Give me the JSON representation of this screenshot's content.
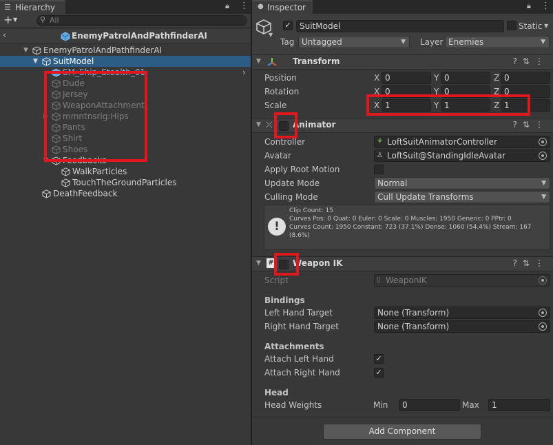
{
  "hierarchy": {
    "tab_label": "Hierarchy",
    "search_placeholder": "All",
    "scene_title": "EnemyPatrolAndPathfinderAI",
    "items": [
      {
        "label": "EnemyPatrolAndPathfinderAI"
      },
      {
        "label": "SuitModel"
      },
      {
        "label": "SM_Ship_Stealth_01"
      },
      {
        "label": "Dude"
      },
      {
        "label": "Jersey"
      },
      {
        "label": "WeaponAttachment"
      },
      {
        "label": "mmntnsrig:Hips"
      },
      {
        "label": "Pants"
      },
      {
        "label": "Shirt"
      },
      {
        "label": "Shoes"
      },
      {
        "label": "Feedbacks"
      },
      {
        "label": "WalkParticles"
      },
      {
        "label": "TouchTheGroundParticles"
      },
      {
        "label": "DeathFeedback"
      }
    ]
  },
  "inspector": {
    "tab_label": "Inspector",
    "object_name": "SuitModel",
    "static_label": "Static",
    "tag_label": "Tag",
    "tag_value": "Untagged",
    "layer_label": "Layer",
    "layer_value": "Enemies",
    "transform": {
      "title": "Transform",
      "position_label": "Position",
      "rotation_label": "Rotation",
      "scale_label": "Scale",
      "x": "X",
      "y": "Y",
      "z": "Z",
      "position": [
        "0",
        "0",
        "0"
      ],
      "rotation": [
        "0",
        "0",
        "0"
      ],
      "scale": [
        "1",
        "1",
        "1"
      ]
    },
    "animator": {
      "title": "Animator",
      "controller_label": "Controller",
      "controller_value": "LoftSuitAnimatorController",
      "avatar_label": "Avatar",
      "avatar_value": "LoftSuit@StandingIdleAvatar",
      "apply_root_motion_label": "Apply Root Motion",
      "update_mode_label": "Update Mode",
      "update_mode_value": "Normal",
      "culling_mode_label": "Culling Mode",
      "culling_mode_value": "Cull Update Transforms",
      "info_line1": "Clip Count: 15",
      "info_line2": "Curves Pos: 0 Quat: 0 Euler: 0 Scale: 0 Muscles: 1950 Generic: 0 PPtr: 0",
      "info_line3": "Curves Count: 1950 Constant: 723 (37.1%) Dense: 1060 (54.4%) Stream: 167",
      "info_line4": "(8.6%)"
    },
    "weapon_ik": {
      "title": "Weapon IK",
      "script_label": "Script",
      "script_value": "WeaponIK",
      "bindings_header": "Bindings",
      "left_hand_target_label": "Left Hand Target",
      "left_hand_target_value": "None (Transform)",
      "right_hand_target_label": "Right Hand Target",
      "right_hand_target_value": "None (Transform)",
      "attachments_header": "Attachments",
      "attach_left_label": "Attach Left Hand",
      "attach_right_label": "Attach Right Hand",
      "head_header": "Head",
      "head_weights_label": "Head Weights",
      "min_label": "Min",
      "min_value": "0",
      "max_label": "Max",
      "max_value": "1"
    },
    "add_component_label": "Add Component"
  },
  "colors": {
    "selection": "#2c5d87",
    "highlight_box": "#e0171f",
    "panel_bg": "#383838"
  }
}
